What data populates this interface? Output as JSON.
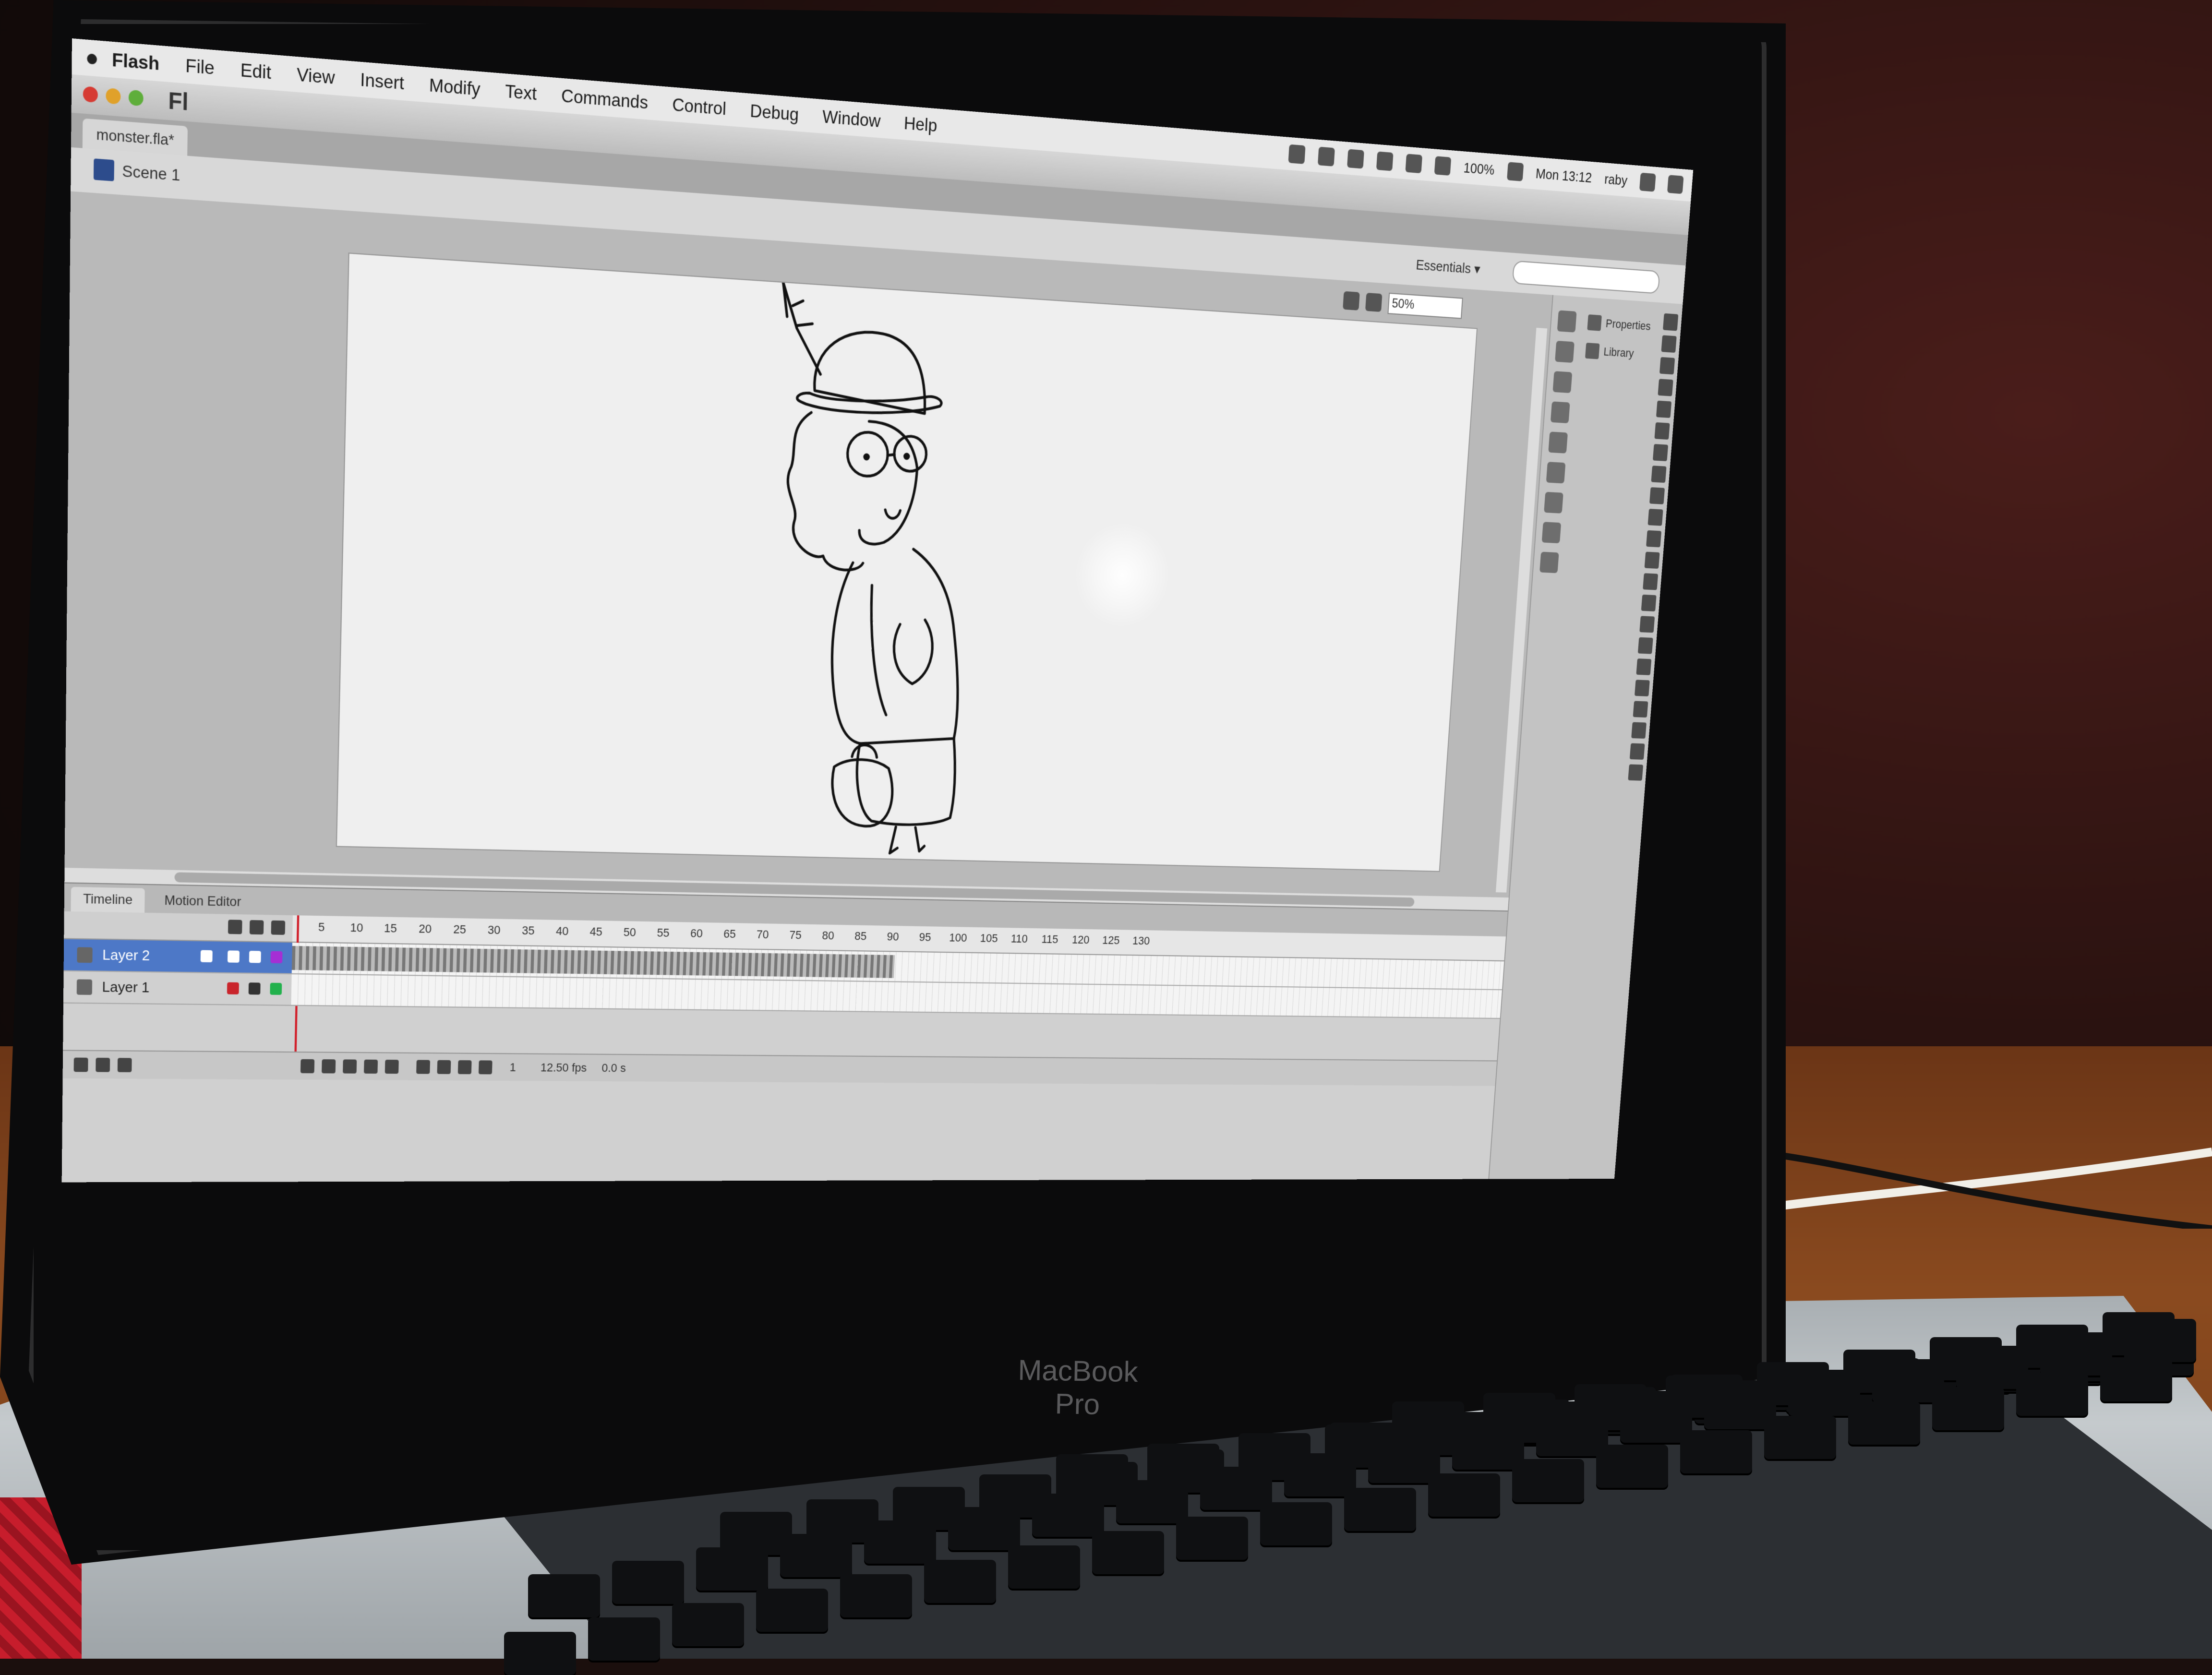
{
  "menubar": {
    "app_name": "Flash",
    "items": [
      "File",
      "Edit",
      "View",
      "Insert",
      "Modify",
      "Text",
      "Commands",
      "Control",
      "Debug",
      "Window",
      "Help"
    ],
    "status": {
      "battery": "100%",
      "clock": "Mon 13:12",
      "user": "raby"
    }
  },
  "app": {
    "logo": "Fl",
    "document_tab": "monster.fla*"
  },
  "editbar": {
    "scene": "Scene 1",
    "workspace": "Essentials ▾",
    "search_placeholder": ""
  },
  "stage": {
    "zoom": "50%"
  },
  "panels": {
    "properties": "Properties",
    "library": "Library"
  },
  "timeline": {
    "tabs": [
      "Timeline",
      "Motion Editor"
    ],
    "ruler": [
      "5",
      "10",
      "15",
      "20",
      "25",
      "30",
      "35",
      "40",
      "45",
      "50",
      "55",
      "60",
      "65",
      "70",
      "75",
      "80",
      "85",
      "90",
      "95",
      "100",
      "105",
      "110",
      "115",
      "120",
      "125",
      "130"
    ],
    "layers": [
      {
        "name": "Layer 2",
        "selected": true
      },
      {
        "name": "Layer 1",
        "selected": false
      }
    ],
    "current_frame": "1",
    "fps": "12.50 fps",
    "elapsed": "0.0 s"
  },
  "hardware": {
    "label": "MacBook Pro"
  },
  "colors": {
    "selection": "#4d78c7",
    "playhead": "#d1202b",
    "stage": "#efefef"
  }
}
